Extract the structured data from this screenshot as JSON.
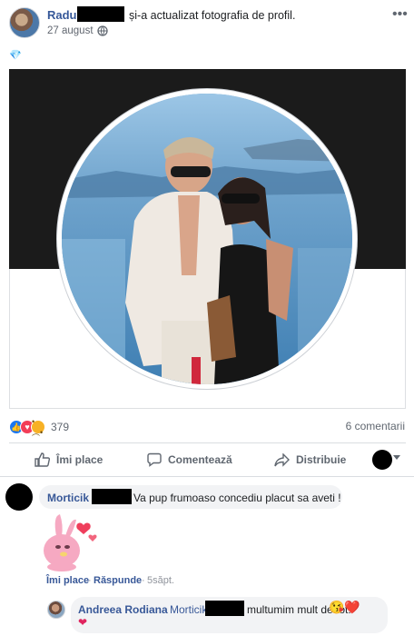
{
  "post": {
    "author": "Radu",
    "action": "și-a actualizat fotografia de profil.",
    "date": "27 august",
    "more": "•••",
    "diamond": "💎"
  },
  "reactions": {
    "count": "379",
    "comments": "6 comentarii"
  },
  "actions": {
    "like": "Îmi place",
    "comment": "Comentează",
    "share": "Distribuie"
  },
  "comments": [
    {
      "author": "Morticik",
      "text": "Va pup frumoaso concediu placut sa aveti !",
      "like": "Îmi place",
      "reply": "Răspunde",
      "time": "5săpt."
    }
  ],
  "reply": {
    "author": "Andreea Rodiana",
    "mention": "Morticik",
    "text": "multumim mult de tot!",
    "emoji": "😘❤️",
    "heart": "❤"
  },
  "colors": {
    "link": "#385898",
    "brand": "#1877f2",
    "love": "#f33e58"
  }
}
